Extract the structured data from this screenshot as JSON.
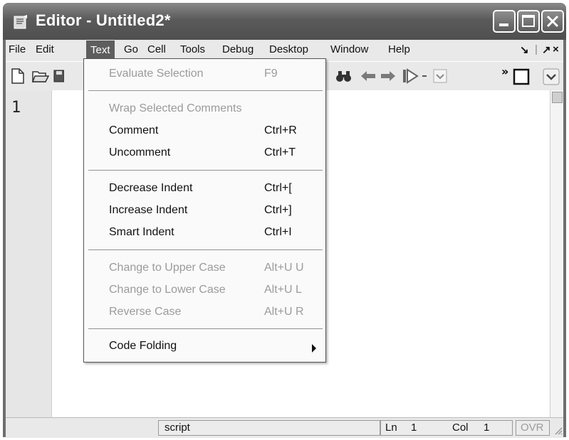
{
  "window": {
    "title": "Editor - Untitled2*"
  },
  "menubar": {
    "items": [
      "File",
      "Edit",
      "Text",
      "Go",
      "Cell",
      "Tools",
      "Debug",
      "Desktop",
      "Window",
      "Help"
    ],
    "active": "Text",
    "right_glyphs": [
      "↘",
      "|",
      "↗",
      "×"
    ]
  },
  "editor": {
    "line_number": "1"
  },
  "text_menu": {
    "items": [
      {
        "label": "Evaluate Selection",
        "shortcut": "F9",
        "enabled": false
      },
      {
        "label": "Wrap Selected Comments",
        "shortcut": "",
        "enabled": false
      },
      {
        "label": "Comment",
        "shortcut": "Ctrl+R",
        "enabled": true
      },
      {
        "label": "Uncomment",
        "shortcut": "Ctrl+T",
        "enabled": true
      },
      {
        "label": "Decrease Indent",
        "shortcut": "Ctrl+[",
        "enabled": true
      },
      {
        "label": "Increase Indent",
        "shortcut": "Ctrl+]",
        "enabled": true
      },
      {
        "label": "Smart Indent",
        "shortcut": "Ctrl+I",
        "enabled": true
      },
      {
        "label": "Change to Upper Case",
        "shortcut": "Alt+U U",
        "enabled": false
      },
      {
        "label": "Change to Lower Case",
        "shortcut": "Alt+U L",
        "enabled": false
      },
      {
        "label": "Reverse Case",
        "shortcut": "Alt+U R",
        "enabled": false
      },
      {
        "label": "Code Folding",
        "shortcut": "",
        "enabled": true,
        "submenu": true
      }
    ]
  },
  "statusbar": {
    "mode": "script",
    "ln_label": "Ln",
    "ln_value": "1",
    "col_label": "Col",
    "col_value": "1",
    "ovr": "OVR"
  },
  "toolbar": {
    "icons": [
      "new-file-icon",
      "open-folder-icon",
      "save-icon",
      "find-binoculars-icon",
      "back-arrow-icon",
      "forward-arrow-icon",
      "run-icon",
      "dropdown-icon",
      "overflow-icon",
      "dock-icon"
    ]
  }
}
